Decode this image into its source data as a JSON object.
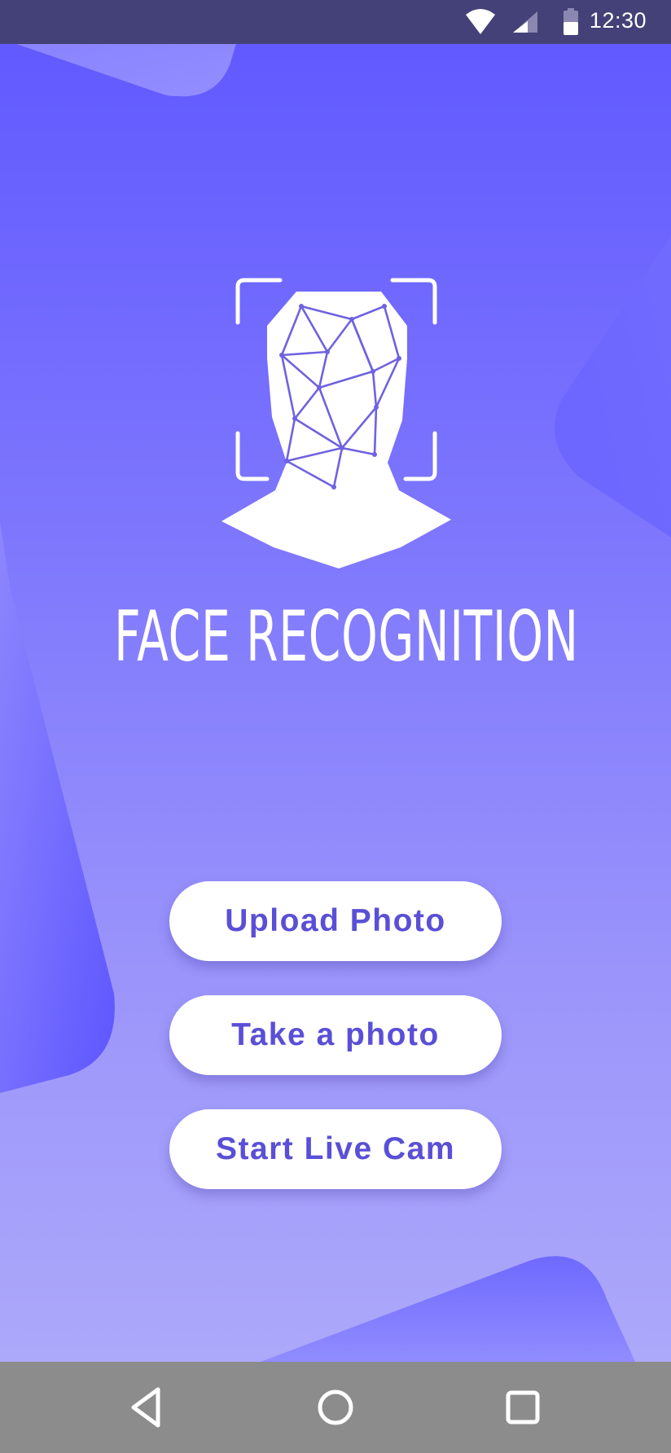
{
  "status_bar": {
    "time": "12:30",
    "icons": [
      "wifi-icon",
      "cellular-signal-icon",
      "battery-icon"
    ]
  },
  "app": {
    "logo_icon": "face-scan-icon",
    "title": "FACE RECOGNITION"
  },
  "actions": {
    "upload_label": "Upload Photo",
    "take_photo_label": "Take a photo",
    "live_cam_label": "Start Live Cam"
  },
  "navigation": {
    "icons": [
      "back-icon",
      "home-icon",
      "recents-icon"
    ]
  },
  "colors": {
    "status_bar": "#444178",
    "gradient_top": "#5f57ff",
    "gradient_bottom": "#b0adfa",
    "button_text": "#5a4fd6",
    "nav_bar": "#8c8c8c"
  }
}
